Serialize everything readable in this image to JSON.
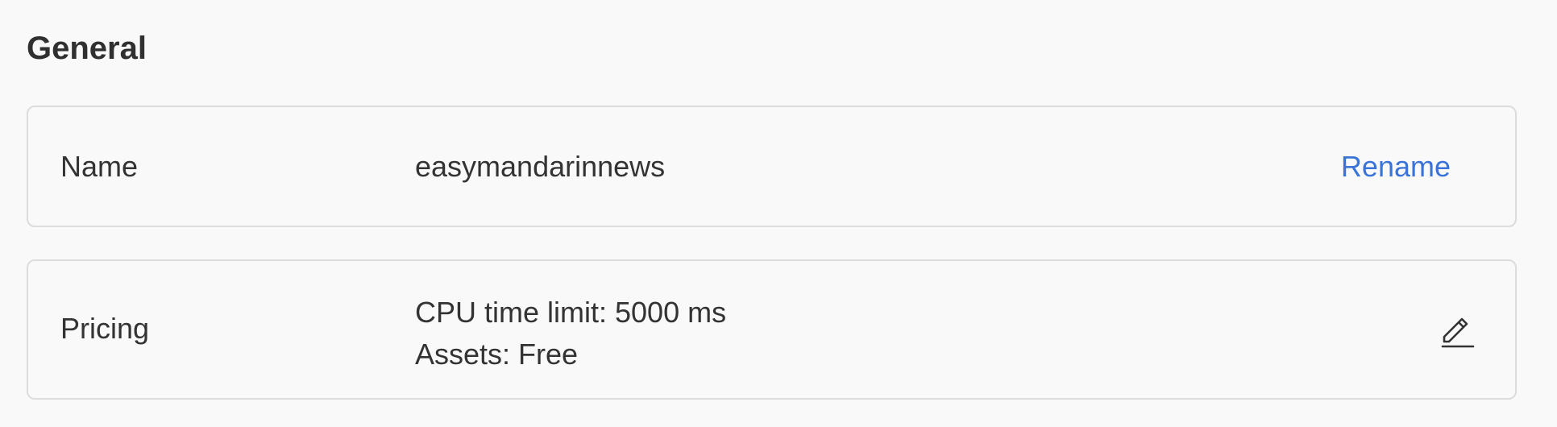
{
  "section": {
    "title": "General"
  },
  "name_row": {
    "label": "Name",
    "value": "easymandarinnews",
    "action_label": "Rename"
  },
  "pricing_row": {
    "label": "Pricing",
    "lines": [
      "CPU time limit: 5000 ms",
      "Assets: Free"
    ],
    "action_icon": "pencil-edit-icon"
  },
  "colors": {
    "background": "#f9f9f9",
    "text": "#333333",
    "link": "#3a74d9",
    "border": "#dcdcdc"
  }
}
